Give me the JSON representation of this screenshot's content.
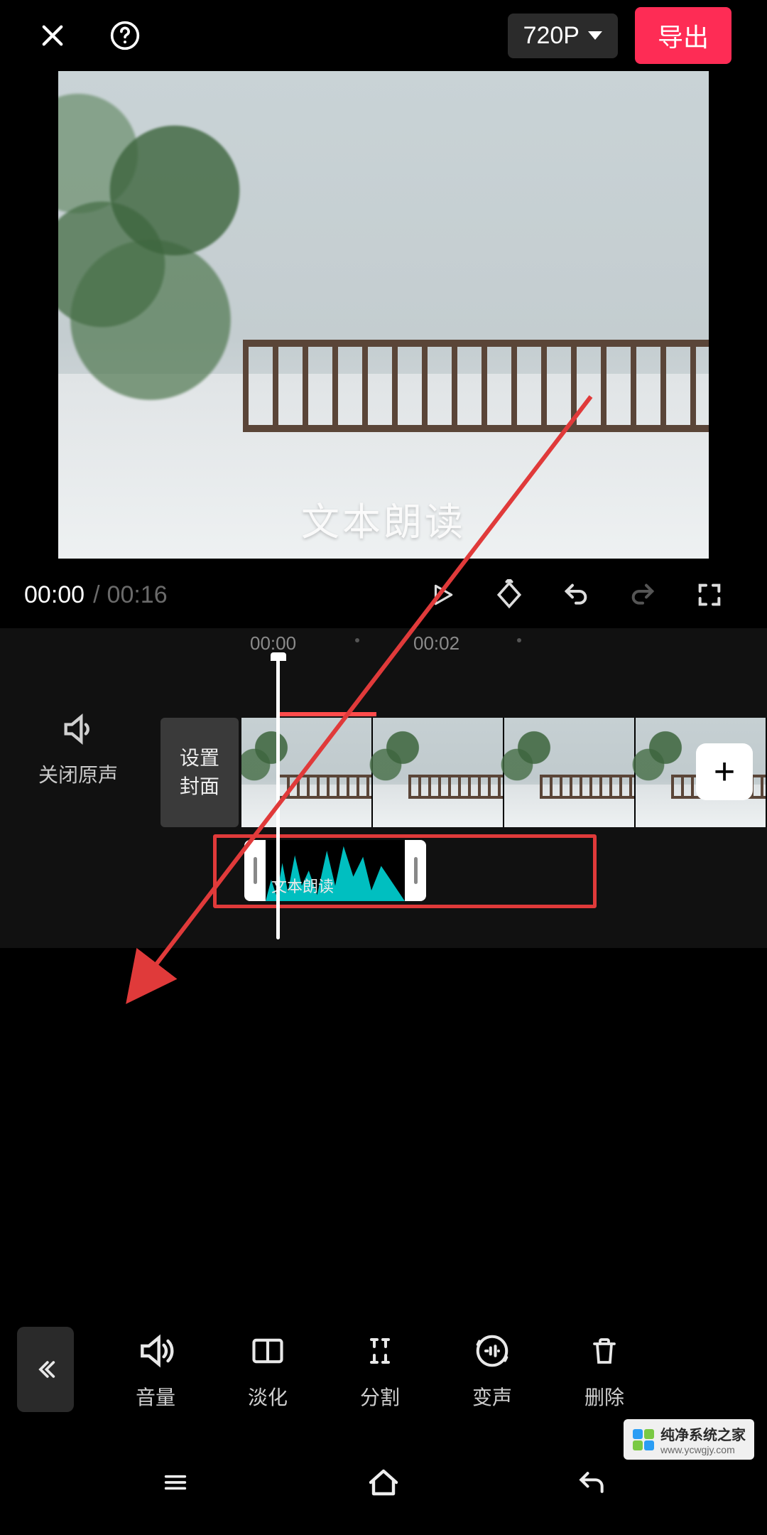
{
  "header": {
    "resolution_label": "720P",
    "export_label": "导出"
  },
  "preview": {
    "overlay_text": "文本朗读"
  },
  "playbar": {
    "current_time": "00:00",
    "total_time": "00:16"
  },
  "timeline": {
    "ticks": [
      "00:00",
      "00:02"
    ],
    "mute_label": "关闭原声",
    "cover_button_label": "设置\n封面",
    "audio_clip_label": "文本朗读"
  },
  "toolbar": {
    "items": [
      {
        "id": "volume",
        "label": "音量"
      },
      {
        "id": "fade",
        "label": "淡化"
      },
      {
        "id": "split",
        "label": "分割"
      },
      {
        "id": "voice",
        "label": "变声"
      },
      {
        "id": "delete",
        "label": "删除"
      }
    ]
  },
  "watermark": {
    "title": "纯净系统之家",
    "url": "www.ycwgjy.com"
  },
  "colors": {
    "accent": "#fe2c55",
    "highlight": "#e03a3a",
    "wave": "#00bfc0"
  }
}
